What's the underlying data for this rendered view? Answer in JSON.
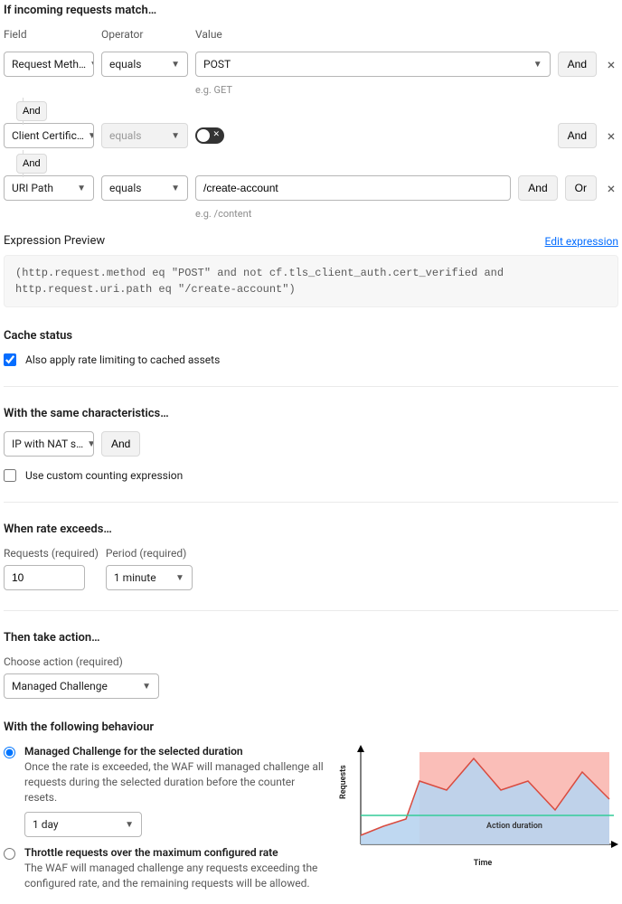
{
  "incoming": {
    "title": "If incoming requests match…",
    "labels": {
      "field": "Field",
      "operator": "Operator",
      "value": "Value"
    },
    "rows": [
      {
        "field": "Request Meth…",
        "operator": "equals",
        "value": "POST",
        "hint": "e.g. GET",
        "type": "select",
        "actions": [
          "And"
        ]
      },
      {
        "field": "Client Certific…",
        "operator": "equals",
        "opDisabled": true,
        "type": "toggle",
        "actions": [
          "And"
        ]
      },
      {
        "field": "URI Path",
        "operator": "equals",
        "value": "/create-account",
        "hint": "e.g. /content",
        "type": "input",
        "actions": [
          "And",
          "Or"
        ]
      }
    ],
    "connector": "And"
  },
  "expression": {
    "title": "Expression Preview",
    "edit": "Edit expression",
    "code": "(http.request.method eq \"POST\" and not cf.tls_client_auth.cert_verified and http.request.uri.path eq \"/create-account\")"
  },
  "cache": {
    "title": "Cache status",
    "checkbox": "Also apply rate limiting to cached assets",
    "checked": true
  },
  "characteristics": {
    "title": "With the same characteristics…",
    "select": "IP with NAT s…",
    "and": "And",
    "custom": "Use custom counting expression",
    "customChecked": false
  },
  "rate": {
    "title": "When rate exceeds…",
    "requestsLabel": "Requests (required)",
    "requests": "10",
    "periodLabel": "Period (required)",
    "period": "1 minute"
  },
  "action": {
    "title": "Then take action…",
    "label": "Choose action (required)",
    "value": "Managed Challenge"
  },
  "behaviour": {
    "title": "With the following behaviour",
    "opt1": {
      "title": "Managed Challenge for the selected duration",
      "desc": "Once the rate is exceeded, the WAF will managed challenge all requests during the selected duration before the counter resets.",
      "duration": "1 day"
    },
    "opt2": {
      "title": "Throttle requests over the maximum configured rate",
      "desc": "The WAF will managed challenge any requests exceeding the configured rate, and the remaining requests will be allowed."
    }
  },
  "chart_data": {
    "type": "area",
    "title": "",
    "xlabel": "Time",
    "ylabel": "Requests",
    "x": [
      0,
      1,
      2,
      3,
      4,
      5,
      6,
      7,
      8,
      9,
      10
    ],
    "values": [
      10,
      18,
      25,
      60,
      48,
      85,
      55,
      65,
      35,
      70,
      45
    ],
    "threshold": 28,
    "action_region": {
      "start": 3,
      "end": 10,
      "label": "Action duration"
    }
  }
}
